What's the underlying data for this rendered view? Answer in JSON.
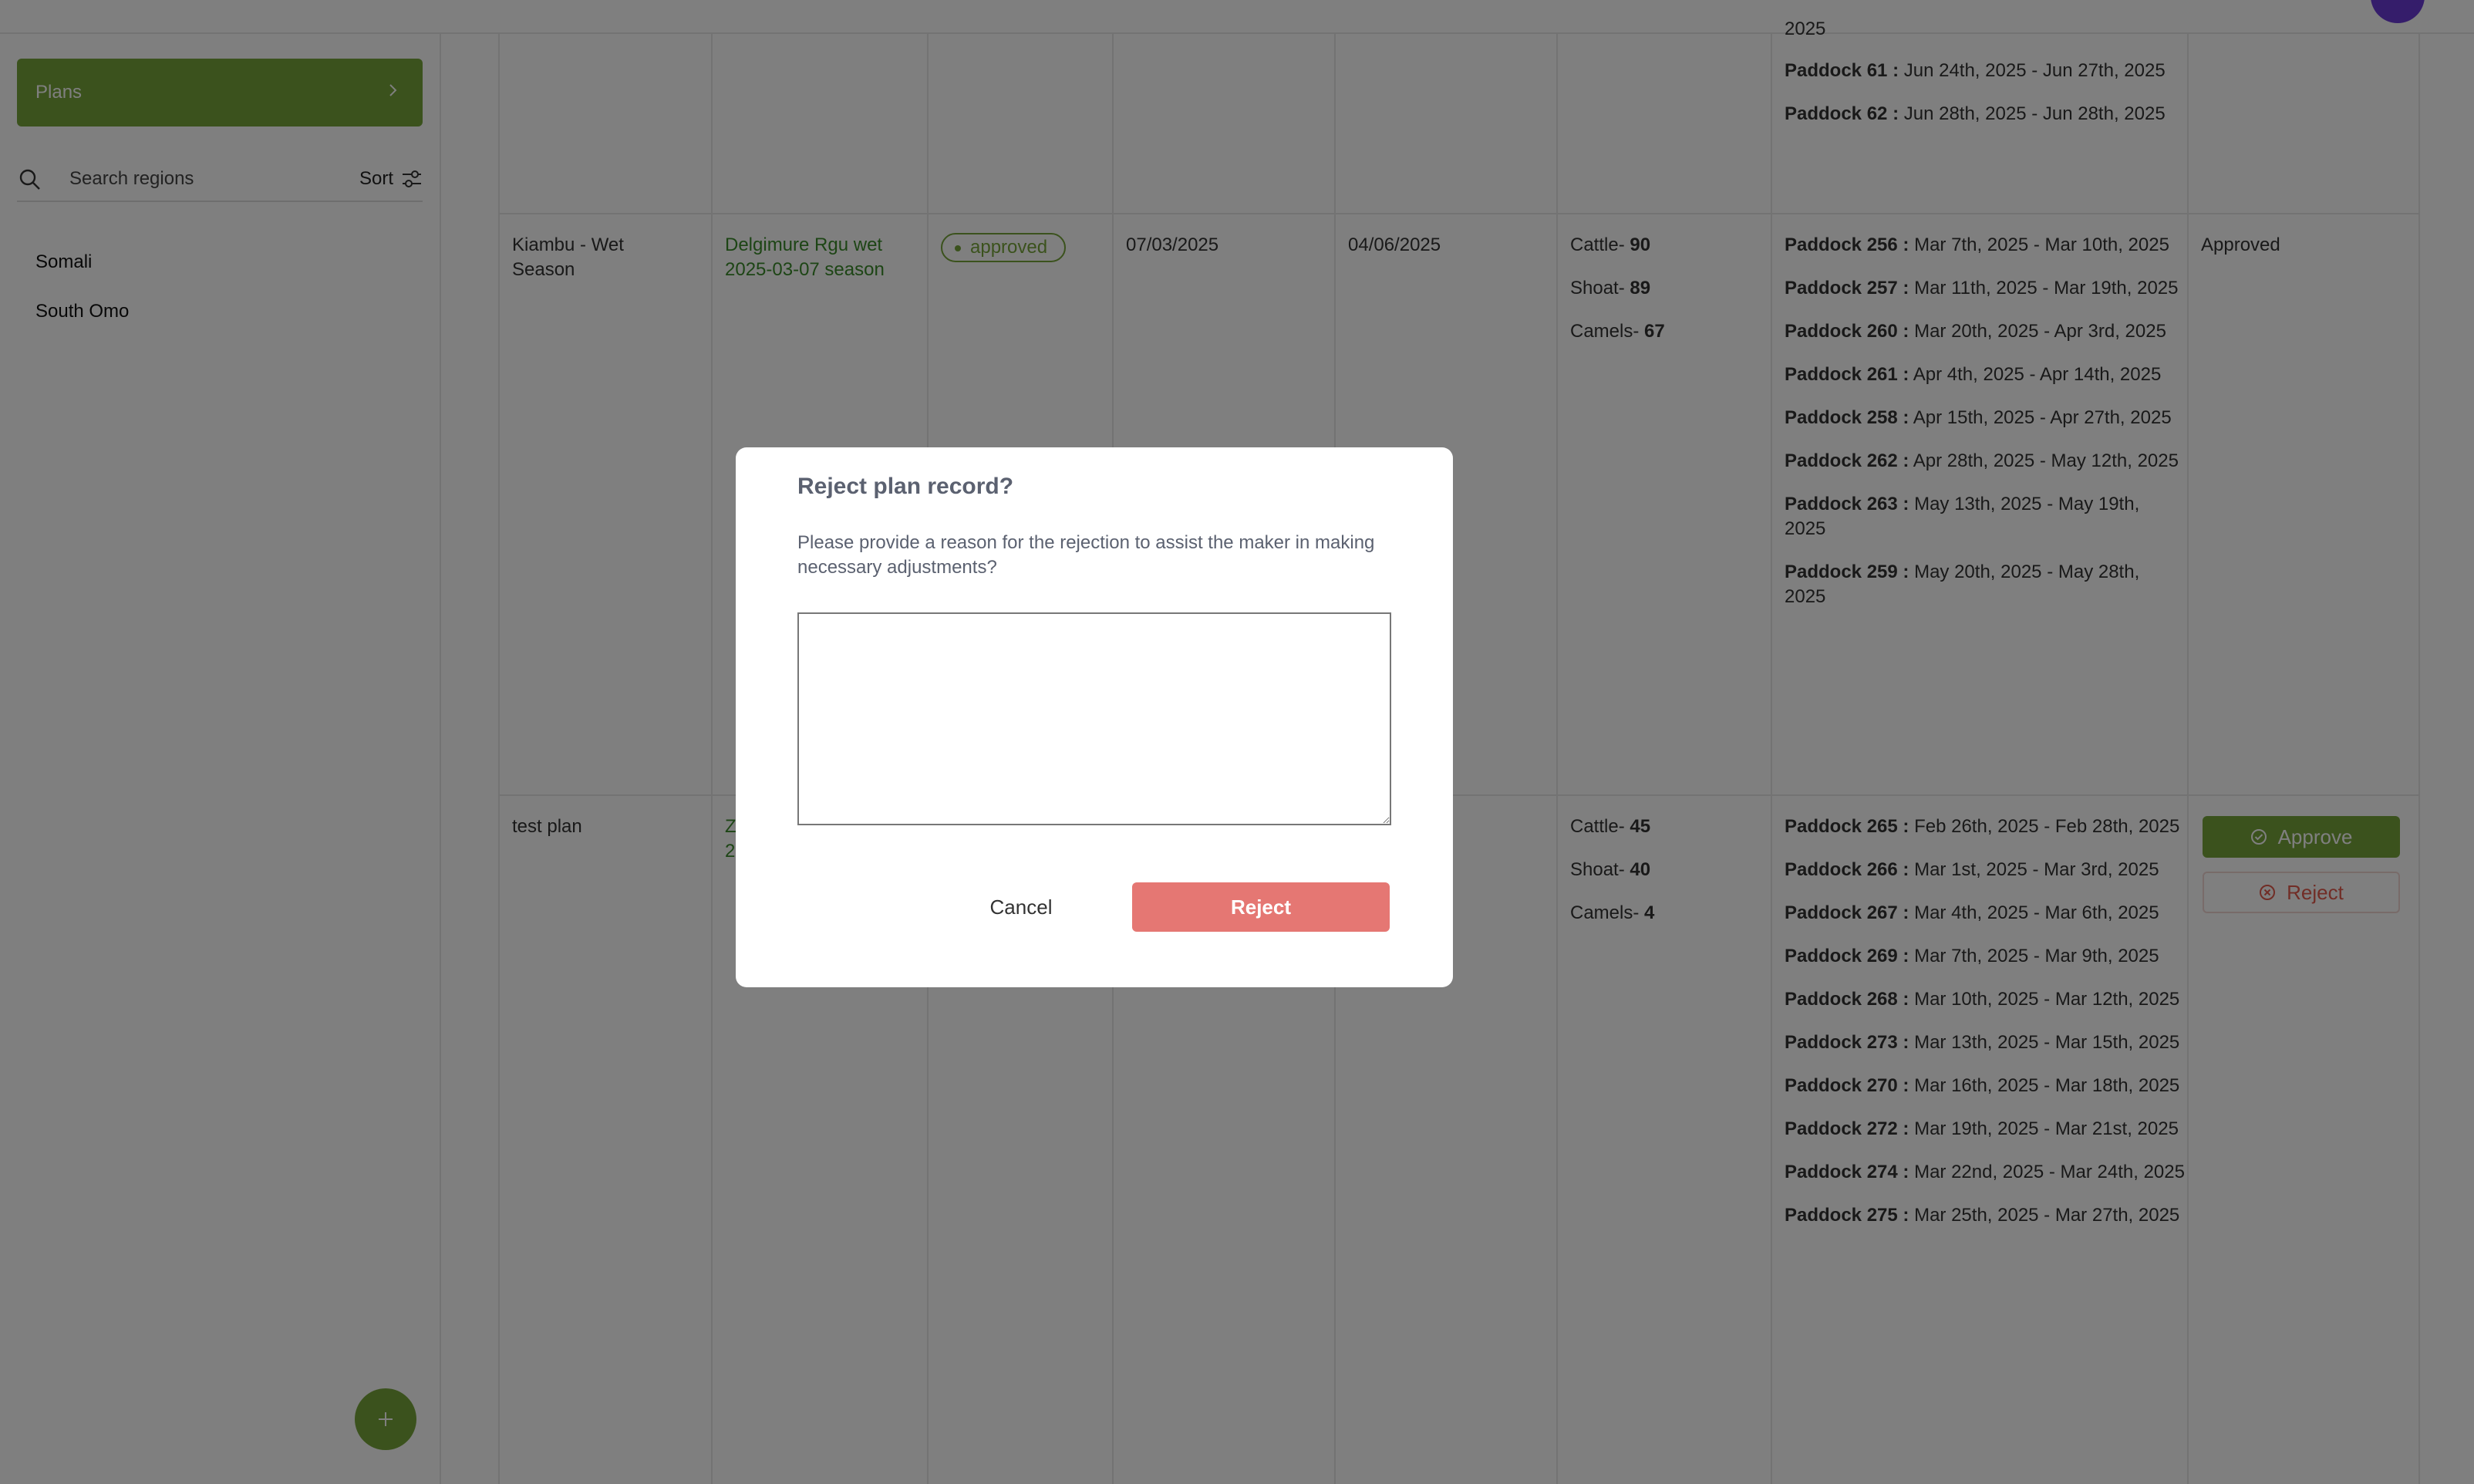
{
  "colors": {
    "brand_green": "#76a53a",
    "avatar_purple": "#6a3ad6",
    "reject_red": "#e57773"
  },
  "sidebar": {
    "plans_label": "Plans",
    "search_placeholder": "Search regions",
    "sort_label": "Sort",
    "regions": [
      "Somali",
      "South Omo"
    ],
    "add_icon": "plus-icon"
  },
  "table": {
    "top_partial": {
      "paddocks": [
        {
          "label": "Paddock 61 :",
          "dates": "Jun 24th, 2025 - Jun 27th, 2025"
        },
        {
          "label": "Paddock 62 :",
          "dates": "Jun 28th, 2025 - Jun 28th, 2025"
        }
      ],
      "clipped_text": "2025"
    },
    "row1": {
      "name": "Kiambu - Wet Season",
      "grazing_plan": "Delgimure Rgu wet 2025-03-07 season",
      "status": "approved",
      "start_date": "07/03/2025",
      "end_date": "04/06/2025",
      "animals": [
        {
          "label": "Cattle- ",
          "count": "90"
        },
        {
          "label": "Shoat- ",
          "count": "89"
        },
        {
          "label": "Camels- ",
          "count": "67"
        }
      ],
      "paddocks": [
        {
          "label": "Paddock 256 :",
          "dates": "Mar 7th, 2025 - Mar 10th, 2025"
        },
        {
          "label": "Paddock 257 :",
          "dates": "Mar 11th, 2025 - Mar 19th, 2025"
        },
        {
          "label": "Paddock 260 :",
          "dates": "Mar 20th, 2025 - Apr 3rd, 2025"
        },
        {
          "label": "Paddock 261 :",
          "dates": "Apr 4th, 2025 - Apr 14th, 2025"
        },
        {
          "label": "Paddock 258 :",
          "dates": "Apr 15th, 2025 - Apr 27th, 2025"
        },
        {
          "label": "Paddock 262 :",
          "dates": "Apr 28th, 2025 - May 12th, 2025"
        },
        {
          "label": "Paddock 263 :",
          "dates": "May 13th, 2025 - May 19th, 2025"
        },
        {
          "label": "Paddock 259 :",
          "dates": "May 20th, 2025 - May 28th, 2025"
        }
      ],
      "action_status": "Approved"
    },
    "row2": {
      "name": "test plan",
      "grazing_plan_partial_1": "Z",
      "grazing_plan_partial_2": "2",
      "end_date_partial": "5",
      "animals": [
        {
          "label": "Cattle- ",
          "count": "45"
        },
        {
          "label": "Shoat- ",
          "count": "40"
        },
        {
          "label": "Camels- ",
          "count": "4"
        }
      ],
      "paddocks": [
        {
          "label": "Paddock 265 :",
          "dates": "Feb 26th, 2025 - Feb 28th, 2025"
        },
        {
          "label": "Paddock 266 :",
          "dates": "Mar 1st, 2025 - Mar 3rd, 2025"
        },
        {
          "label": "Paddock 267 :",
          "dates": "Mar 4th, 2025 - Mar 6th, 2025"
        },
        {
          "label": "Paddock 269 :",
          "dates": "Mar 7th, 2025 - Mar 9th, 2025"
        },
        {
          "label": "Paddock 268 :",
          "dates": "Mar 10th, 2025 - Mar 12th, 2025"
        },
        {
          "label": "Paddock 273 :",
          "dates": "Mar 13th, 2025 - Mar 15th, 2025"
        },
        {
          "label": "Paddock 270 :",
          "dates": "Mar 16th, 2025 - Mar 18th, 2025"
        },
        {
          "label": "Paddock 272 :",
          "dates": "Mar 19th, 2025 - Mar 21st, 2025"
        },
        {
          "label": "Paddock 274 :",
          "dates": "Mar 22nd, 2025 - Mar 24th, 2025"
        },
        {
          "label": "Paddock 275 :",
          "dates": "Mar 25th, 2025 - Mar 27th, 2025"
        }
      ],
      "approve_label": "Approve",
      "reject_label": "Reject"
    }
  },
  "modal": {
    "title": "Reject plan record?",
    "description": "Please provide a reason for the rejection to assist the maker in making necessary adjustments?",
    "textarea_value": "",
    "cancel_label": "Cancel",
    "reject_label": "Reject"
  }
}
